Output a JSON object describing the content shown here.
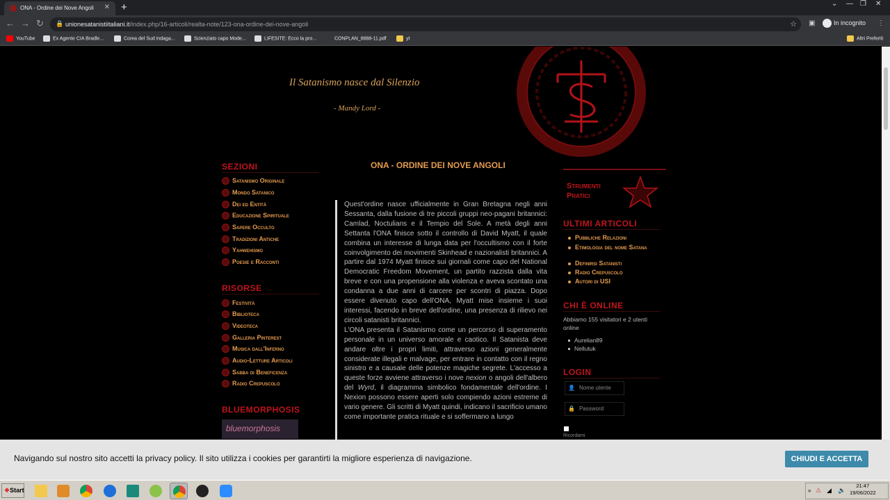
{
  "browser": {
    "tab_title": "ONA - Ordine dei Nove Angoli",
    "tab_close": "✕",
    "new_tab": "+",
    "url_host": "unionesatanistiitaliani.it",
    "url_path": "/index.php/16-articoli/realta-note/123-ona-ordine-dei-nove-angoli",
    "incognito_label": "In incognito",
    "bookmarks": [
      {
        "label": "YouTube",
        "color": "#ff0000"
      },
      {
        "label": "Ex Agente CIA Bradle...",
        "color": "#dddddd"
      },
      {
        "label": "Corea del Sud indaga...",
        "color": "#dddddd"
      },
      {
        "label": "Scienziato capo Mode...",
        "color": "#dddddd"
      },
      {
        "label": "LIFESITE: Ecco la pro...",
        "color": "#dddddd"
      },
      {
        "label": "CONPLAN_8888-11.pdf",
        "color": "#35363a"
      },
      {
        "label": "yt",
        "color": "#f2c94c"
      }
    ],
    "other_bookmarks": "Altri Preferiti"
  },
  "header": {
    "quote": "Il Satanismo nasce dal Silenzio",
    "author": "- Mandy Lord -"
  },
  "sidebar_left": {
    "sections_title": "SEZIONI",
    "sections": [
      "Satanismo Originale",
      "Mondo Satanico",
      "Dei ed Entità",
      "Educazione Spirituale",
      "Sapere Occulto",
      "Tradizioni Antiche",
      "Yahwehismo",
      "Poesie e Racconti"
    ],
    "resources_title": "RISORSE",
    "resources": [
      "Festività",
      "Biblioteca",
      "Videoteca",
      "Galleria Pinterest",
      "Musica dall'Inferno",
      "Audio-Letture Articoli",
      "Sabba di Beneficenza",
      "Radio Crepuscolo"
    ],
    "bluemorphosis_title": "BLUEMORPHOSIS",
    "bluemorphosis_logo": "bluemorphosis"
  },
  "article": {
    "title": "ONA - ORDINE DEI NOVE ANGOLI",
    "p1": "Quest'ordine nasce ufficialmente in Gran Bretagna negli anni Sessanta, dalla fusione di tre piccoli gruppi neo-pagani britannici: Camlad, Noctulians e il Tempio del Sole. A metà degli anni Settanta l'ONA finisce sotto il controllo di David Myatt, il quale combina un interesse di lunga data per l'occultismo con il forte coinvolgimento dei movimenti Skinhead e nazionalisti britannici. A partire dal 1974 Myatt finisce sui giornali come capo del National Democratic Freedom Movement, un partito razzista dalla vita breve e con una propensione alla violenza e aveva scontato una condanna a due anni di carcere per scontri di piazza. Dopo essere divenuto capo dell'ONA, Myatt mise insieme i suoi interessi, facendo in breve dell'ordine, una presenza di rilievo nei circoli satanisti britannici.",
    "p2_a": "L'ONA presenta il Satanismo come un percorso di superamento personale in un universo amorale e caotico. Il Satanista deve andare oltre i propri limiti, attraverso azioni generalmente considerate illegali e malvage, per entrare in contatto con il regno sinistro e a causale delle potenze magiche segrete. L'accesso a queste forze avviene attraverso i nove ",
    "p2_nexion": "nexion",
    "p2_b": " o angoli dell'albero del ",
    "p2_wyrd": "Wyrd",
    "p2_c": ", il diagramma simbolico fondamentale dell'ordine. I Nexion possono essere aperti solo compiendo azioni estreme di vario genere. Gli scritti di Myatt quindi, indicano il sacrificio umano come importante pratica rituale e si soffermano a lungo"
  },
  "sidebar_right": {
    "tools_title_1": "Strumenti",
    "tools_title_2": "Pratici",
    "latest_title": "ULTIMI ARTICOLI",
    "latest": [
      "Pubbliche Relazioni",
      "Etimologia del nome Satana",
      "Definirsi Satanisti",
      "Radio Crepuscolo",
      "Autori di USI"
    ],
    "online_title": "CHI È ONLINE",
    "online_text": "Abbiamo 155 visitatori e 2 utenti online",
    "online_users": [
      "Aurelian89",
      "Nellutuk"
    ],
    "login_title": "LOGIN",
    "username_placeholder": "Nome utente",
    "password_placeholder": "Password",
    "remember_label": "Ricordami"
  },
  "cookie": {
    "message": "Navigando sul nostro sito accetti la privacy policy. Il sito utilizza i cookies per garantirti la migliore esperienza di navigazione.",
    "button": "CHIUDI E ACCETTA"
  },
  "taskbar": {
    "start_label": "Start",
    "time": "21:47",
    "date": "19/06/2022"
  },
  "colors": {
    "accent_red": "#c0141d",
    "menu_orange": "#e59b4f",
    "cookie_button": "#3d8aab"
  }
}
